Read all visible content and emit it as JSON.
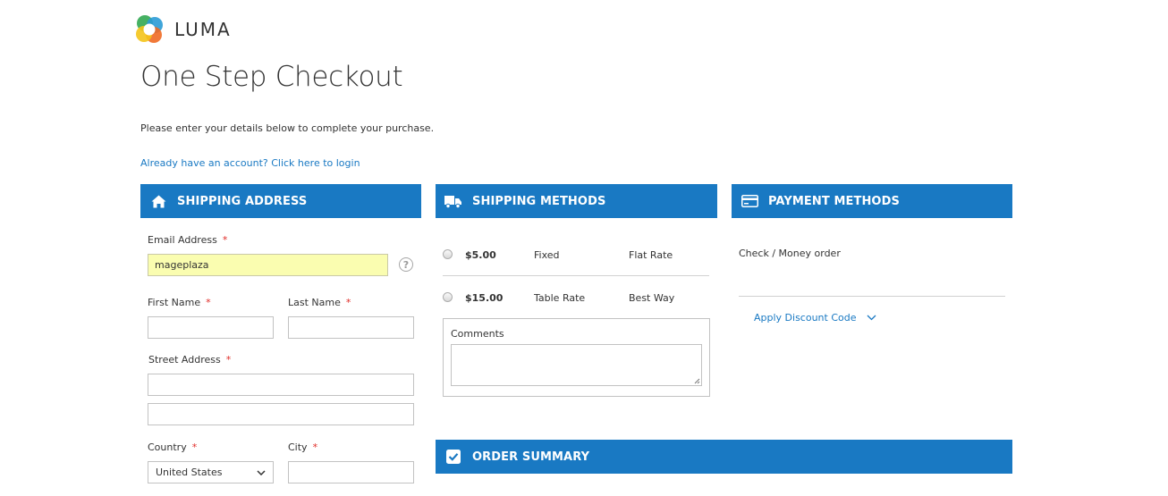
{
  "brand": {
    "name": "LUMA"
  },
  "page": {
    "title": "One Step Checkout",
    "intro": "Please enter your details below to complete your purchase.",
    "login_link": "Already have an account? Click here to login"
  },
  "shipping_address": {
    "header": "SHIPPING ADDRESS",
    "icon": "home-icon",
    "email": {
      "label": "Email Address",
      "value": "mageplaza"
    },
    "first_name": {
      "label": "First Name",
      "value": ""
    },
    "last_name": {
      "label": "Last Name",
      "value": ""
    },
    "street": {
      "label": "Street Address",
      "line1": "",
      "line2": ""
    },
    "country": {
      "label": "Country",
      "selected": "United States"
    },
    "city": {
      "label": "City",
      "value": ""
    }
  },
  "shipping_methods": {
    "header": "SHIPPING METHODS",
    "icon": "truck-icon",
    "options": [
      {
        "price": "$5.00",
        "method": "Fixed",
        "carrier": "Flat Rate"
      },
      {
        "price": "$15.00",
        "method": "Table Rate",
        "carrier": "Best Way"
      }
    ],
    "comments_label": "Comments"
  },
  "payment_methods": {
    "header": "PAYMENT METHODS",
    "icon": "credit-card-icon",
    "option": "Check / Money order",
    "discount_link": "Apply Discount Code"
  },
  "order_summary": {
    "header": "ORDER SUMMARY",
    "icon": "checkbox-icon"
  },
  "colors": {
    "accent": "#1979c3",
    "required": "#e02b27",
    "autofill": "#fafdb0"
  }
}
